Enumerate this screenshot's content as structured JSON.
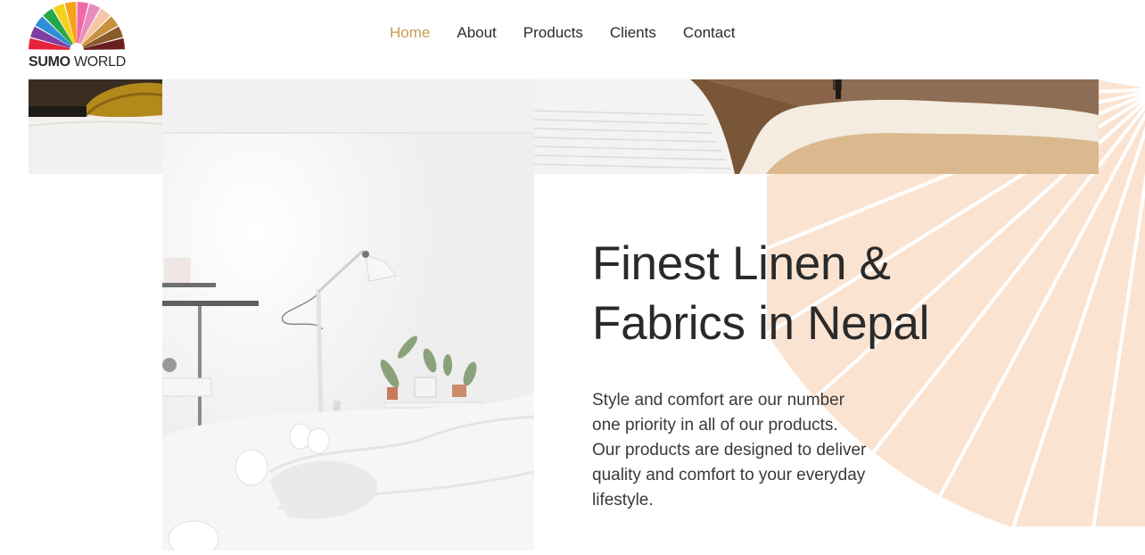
{
  "brand": {
    "name_bold": "SUMO",
    "name_light": "WORLD",
    "fan_colors": [
      "#e6233a",
      "#7d3fa0",
      "#2f8fd6",
      "#26a84a",
      "#f2d21c",
      "#f7a11a",
      "#f06aa8",
      "#e88cbf",
      "#f5c6a5",
      "#c7913f",
      "#8a5a2b",
      "#6a1f1f"
    ]
  },
  "nav": {
    "items": [
      {
        "label": "Home",
        "active": true
      },
      {
        "label": "About",
        "active": false
      },
      {
        "label": "Products",
        "active": false
      },
      {
        "label": "Clients",
        "active": false
      },
      {
        "label": "Contact",
        "active": false
      }
    ],
    "active_color": "#c99a52"
  },
  "hero": {
    "title_line1": "Finest Linen &",
    "title_line2": "Fabrics in Nepal",
    "description": "Style and comfort are our number one priority in all of our products. Our products are designed to deliver quality and comfort to your everyday lifestyle.",
    "accent_color": "#fbe3d1"
  }
}
